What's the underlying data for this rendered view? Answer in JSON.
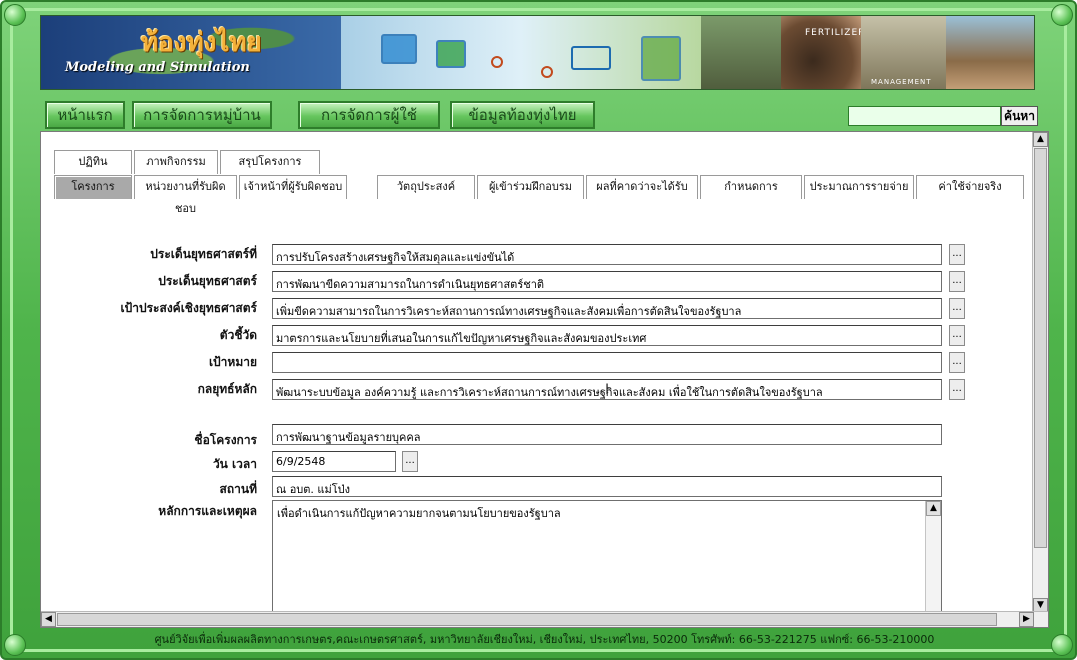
{
  "banner": {
    "title": "ท้องทุ่งไทย",
    "subtitle": "Modeling and Simulation",
    "photo_stamp_fertilizers": "FERTILIZERS",
    "photo_stamp_management": "MANAGEMENT"
  },
  "nav": {
    "items": [
      "หน้าแรก",
      "การจัดการหมู่บ้าน",
      "การจัดการผู้ใช้",
      "ข้อมูลท้องทุ่งไทย"
    ],
    "search_placeholder": "",
    "search_button": "ค้นหา"
  },
  "tabs": {
    "row1": [
      "ปฏิทิน",
      "ภาพกิจกรรม",
      "สรุปโครงการ"
    ],
    "row2": [
      "โครงการ",
      "หน่วยงานที่รับผิดชอบ",
      "เจ้าหน้าที่ผู้รับผิดชอบ",
      "วัตถุประสงค์",
      "ผู้เข้าร่วมฝึกอบรม",
      "ผลที่คาดว่าจะได้รับ",
      "กำหนดการ",
      "ประมาณการรายจ่าย",
      "ค่าใช้จ่ายจริง"
    ],
    "active": "โครงการ"
  },
  "form": {
    "strategic_issue_no_label": "ประเด็นยุทธศาสตร์ที่",
    "strategic_issue_no_value": "การปรับโครงสร้างเศรษฐกิจให้สมดุลและแข่งขันได้",
    "strategic_issue_label": "ประเด็นยุทธศาสตร์",
    "strategic_issue_value": "การพัฒนาขีดความสามารถในการดำเนินยุทธศาสตร์ชาติ",
    "strategic_goal_label": "เป้าประสงค์เชิงยุทธศาสตร์",
    "strategic_goal_value": "เพิ่มขีดความสามารถในการวิเคราะห์สถานการณ์ทางเศรษฐกิจและสังคมเพื่อการตัดสินใจของรัฐบาล",
    "indicator_label": "ตัวชี้วัด",
    "indicator_value": "มาตรการและนโยบายที่เสนอในการแก้ไขปัญหาเศรษฐกิจและสังคมของประเทศ",
    "target_label": "เป้าหมาย",
    "target_value": "",
    "main_strategy_label": "กลยุทธ์หลัก",
    "main_strategy_value": "พัฒนาระบบข้อมูล องค์ความรู้ และการวิเคราะห์สถานการณ์ทางเศรษฐกิจและสังคม เพื่อใช้ในการตัดสินใจของรัฐบาล",
    "project_name_label": "ชื่อโครงการ",
    "project_name_value": "การพัฒนาฐานข้อมูลรายบุคคล",
    "datetime_label": "วัน เวลา",
    "datetime_value": "6/9/2548",
    "place_label": "สถานที่",
    "place_value": "ณ อบต. แม่โป่ง",
    "rationale_label": "หลักการและเหตุผล",
    "rationale_value": "เพื่อดำเนินการแก้ปัญหาความยากจนตามนโยบายของรัฐบาล",
    "dots": "..."
  },
  "footer": {
    "text": "ศูนย์วิจัยเพื่อเพิ่มผลผลิตทางการเกษตร,คณะเกษตรศาสตร์, มหาวิทยาลัยเชียงใหม่, เชียงใหม่, ประเทศไทย, 50200 โทรศัพท์: 66-53-221275 แฟกซ์: 66-53-210000"
  },
  "colors": {
    "frame_green": "#4fb44b",
    "nav_green": "#66c65e",
    "active_tab": "#a9a9a9"
  }
}
